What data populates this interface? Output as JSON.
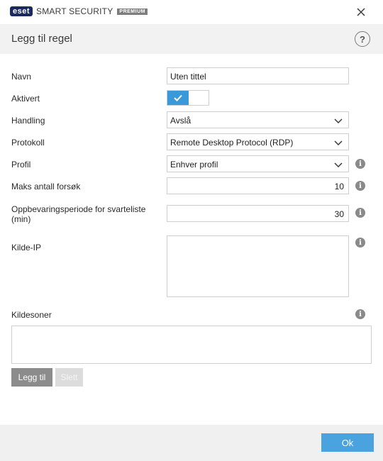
{
  "titlebar": {
    "logo_brand": "eset",
    "logo_product": "SMART SECURITY",
    "logo_tier": "PREMIUM",
    "close_icon": "close-icon"
  },
  "header": {
    "title": "Legg til regel",
    "help_label": "?"
  },
  "form": {
    "name": {
      "label": "Navn",
      "value": "Uten tittel"
    },
    "enabled": {
      "label": "Aktivert",
      "value": true
    },
    "action": {
      "label": "Handling",
      "value": "Avslå"
    },
    "protocol": {
      "label": "Protokoll",
      "value": "Remote Desktop Protocol (RDP)"
    },
    "profile": {
      "label": "Profil",
      "value": "Enhver profil"
    },
    "max_attempts": {
      "label": "Maks antall forsøk",
      "value": "10"
    },
    "retention": {
      "label": "Oppbevaringsperiode for svarteliste (min)",
      "value": "30"
    },
    "source_ip": {
      "label": "Kilde-IP",
      "value": ""
    },
    "source_zones": {
      "label": "Kildesoner",
      "value": ""
    }
  },
  "buttons": {
    "add": "Legg til",
    "delete": "Slett",
    "ok": "Ok"
  },
  "info_glyph": "i",
  "colors": {
    "accent": "#3a9ad9",
    "ok_button": "#4aa3df",
    "brand": "#1b2a5e"
  }
}
